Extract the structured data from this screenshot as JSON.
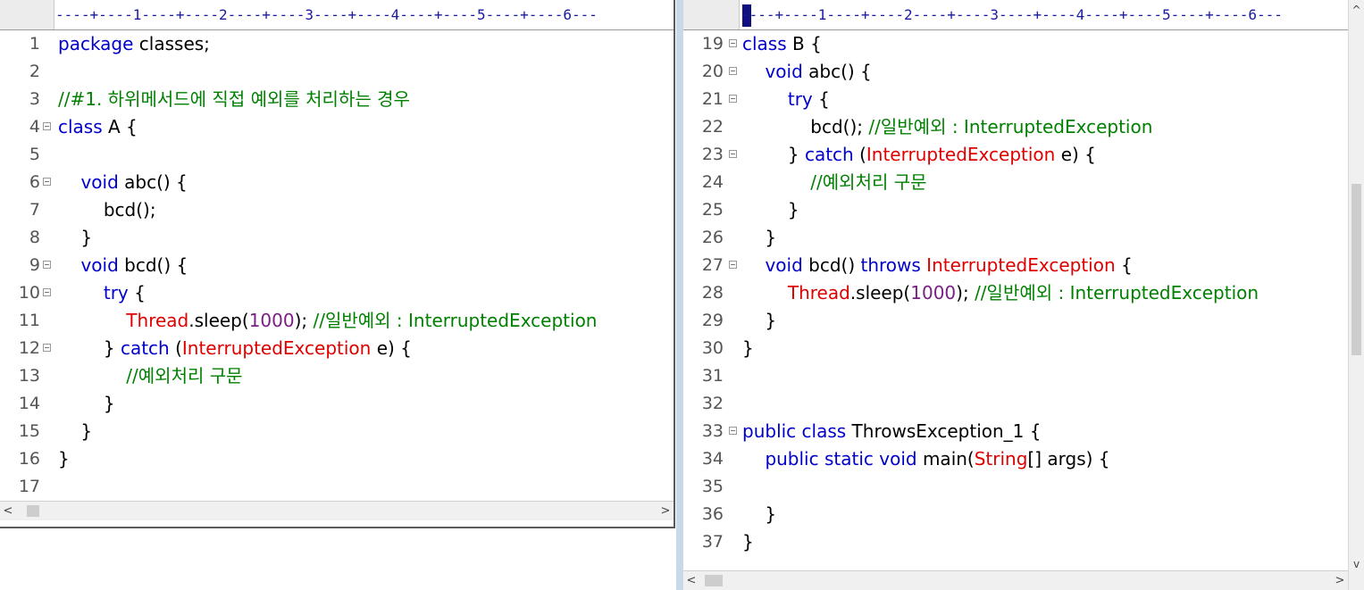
{
  "left_pane": {
    "ruler": "----+----1----+----2----+----3----+----4----+----5----+----6---",
    "lines": [
      {
        "num": "1",
        "fold": false,
        "tokens": [
          {
            "t": "keyword",
            "v": "package"
          },
          {
            "t": "plain",
            "v": " classes;"
          }
        ]
      },
      {
        "num": "2",
        "fold": false,
        "tokens": []
      },
      {
        "num": "3",
        "fold": false,
        "tokens": [
          {
            "t": "comment",
            "v": "//#1. 하위메서드에 직접 예외를 처리하는 경우"
          }
        ]
      },
      {
        "num": "4",
        "fold": true,
        "tokens": [
          {
            "t": "keyword",
            "v": "class"
          },
          {
            "t": "plain",
            "v": " A {"
          }
        ]
      },
      {
        "num": "5",
        "fold": false,
        "tokens": []
      },
      {
        "num": "6",
        "fold": true,
        "tokens": [
          {
            "t": "plain",
            "v": "    "
          },
          {
            "t": "keyword",
            "v": "void"
          },
          {
            "t": "plain",
            "v": " abc() {"
          }
        ]
      },
      {
        "num": "7",
        "fold": false,
        "tokens": [
          {
            "t": "plain",
            "v": "        bcd();"
          }
        ]
      },
      {
        "num": "8",
        "fold": false,
        "tokens": [
          {
            "t": "plain",
            "v": "    }"
          }
        ]
      },
      {
        "num": "9",
        "fold": true,
        "tokens": [
          {
            "t": "plain",
            "v": "    "
          },
          {
            "t": "keyword",
            "v": "void"
          },
          {
            "t": "plain",
            "v": " bcd() {"
          }
        ]
      },
      {
        "num": "10",
        "fold": true,
        "tokens": [
          {
            "t": "plain",
            "v": "        "
          },
          {
            "t": "keyword",
            "v": "try"
          },
          {
            "t": "plain",
            "v": " {"
          }
        ]
      },
      {
        "num": "11",
        "fold": false,
        "tokens": [
          {
            "t": "plain",
            "v": "            "
          },
          {
            "t": "type",
            "v": "Thread"
          },
          {
            "t": "plain",
            "v": ".sleep("
          },
          {
            "t": "number",
            "v": "1000"
          },
          {
            "t": "plain",
            "v": "); "
          },
          {
            "t": "comment",
            "v": "//일반예외 : InterruptedException"
          }
        ]
      },
      {
        "num": "12",
        "fold": true,
        "tokens": [
          {
            "t": "plain",
            "v": "        } "
          },
          {
            "t": "keyword",
            "v": "catch"
          },
          {
            "t": "plain",
            "v": " ("
          },
          {
            "t": "type",
            "v": "InterruptedException"
          },
          {
            "t": "plain",
            "v": " e) {"
          }
        ]
      },
      {
        "num": "13",
        "fold": false,
        "tokens": [
          {
            "t": "plain",
            "v": "            "
          },
          {
            "t": "comment",
            "v": "//예외처리 구문"
          }
        ]
      },
      {
        "num": "14",
        "fold": false,
        "tokens": [
          {
            "t": "plain",
            "v": "        }"
          }
        ]
      },
      {
        "num": "15",
        "fold": false,
        "tokens": [
          {
            "t": "plain",
            "v": "    }"
          }
        ]
      },
      {
        "num": "16",
        "fold": false,
        "tokens": [
          {
            "t": "plain",
            "v": "}"
          }
        ]
      },
      {
        "num": "17",
        "fold": false,
        "tokens": []
      }
    ]
  },
  "right_pane": {
    "ruler": "----+----1----+----2----+----3----+----4----+----5----+----6---",
    "lines": [
      {
        "num": "19",
        "fold": true,
        "tokens": [
          {
            "t": "keyword",
            "v": "class"
          },
          {
            "t": "plain",
            "v": " B {"
          }
        ]
      },
      {
        "num": "20",
        "fold": true,
        "tokens": [
          {
            "t": "plain",
            "v": "    "
          },
          {
            "t": "keyword",
            "v": "void"
          },
          {
            "t": "plain",
            "v": " abc() {"
          }
        ]
      },
      {
        "num": "21",
        "fold": true,
        "tokens": [
          {
            "t": "plain",
            "v": "        "
          },
          {
            "t": "keyword",
            "v": "try"
          },
          {
            "t": "plain",
            "v": " {"
          }
        ]
      },
      {
        "num": "22",
        "fold": false,
        "tokens": [
          {
            "t": "plain",
            "v": "            bcd(); "
          },
          {
            "t": "comment",
            "v": "//일반예외 : InterruptedException"
          }
        ]
      },
      {
        "num": "23",
        "fold": true,
        "tokens": [
          {
            "t": "plain",
            "v": "        } "
          },
          {
            "t": "keyword",
            "v": "catch"
          },
          {
            "t": "plain",
            "v": " ("
          },
          {
            "t": "type",
            "v": "InterruptedException"
          },
          {
            "t": "plain",
            "v": " e) {"
          }
        ]
      },
      {
        "num": "24",
        "fold": false,
        "tokens": [
          {
            "t": "plain",
            "v": "            "
          },
          {
            "t": "comment",
            "v": "//예외처리 구문"
          }
        ]
      },
      {
        "num": "25",
        "fold": false,
        "tokens": [
          {
            "t": "plain",
            "v": "        }"
          }
        ]
      },
      {
        "num": "26",
        "fold": false,
        "tokens": [
          {
            "t": "plain",
            "v": "    }"
          }
        ]
      },
      {
        "num": "27",
        "fold": true,
        "tokens": [
          {
            "t": "plain",
            "v": "    "
          },
          {
            "t": "keyword",
            "v": "void"
          },
          {
            "t": "plain",
            "v": " bcd() "
          },
          {
            "t": "keyword",
            "v": "throws"
          },
          {
            "t": "plain",
            "v": " "
          },
          {
            "t": "type",
            "v": "InterruptedException"
          },
          {
            "t": "plain",
            "v": " {"
          }
        ]
      },
      {
        "num": "28",
        "fold": false,
        "tokens": [
          {
            "t": "plain",
            "v": "        "
          },
          {
            "t": "type",
            "v": "Thread"
          },
          {
            "t": "plain",
            "v": ".sleep("
          },
          {
            "t": "number",
            "v": "1000"
          },
          {
            "t": "plain",
            "v": "); "
          },
          {
            "t": "comment",
            "v": "//일반예외 : InterruptedException"
          }
        ]
      },
      {
        "num": "29",
        "fold": false,
        "tokens": [
          {
            "t": "plain",
            "v": "    }"
          }
        ]
      },
      {
        "num": "30",
        "fold": false,
        "tokens": [
          {
            "t": "plain",
            "v": "}"
          }
        ]
      },
      {
        "num": "31",
        "fold": false,
        "tokens": []
      },
      {
        "num": "32",
        "fold": false,
        "tokens": []
      },
      {
        "num": "33",
        "fold": true,
        "tokens": [
          {
            "t": "keyword",
            "v": "public"
          },
          {
            "t": "plain",
            "v": " "
          },
          {
            "t": "keyword",
            "v": "class"
          },
          {
            "t": "plain",
            "v": " ThrowsException_1 {"
          }
        ]
      },
      {
        "num": "34",
        "fold": false,
        "tokens": [
          {
            "t": "plain",
            "v": "    "
          },
          {
            "t": "keyword",
            "v": "public"
          },
          {
            "t": "plain",
            "v": " "
          },
          {
            "t": "keyword",
            "v": "static"
          },
          {
            "t": "plain",
            "v": " "
          },
          {
            "t": "keyword",
            "v": "void"
          },
          {
            "t": "plain",
            "v": " main("
          },
          {
            "t": "type",
            "v": "String"
          },
          {
            "t": "plain",
            "v": "[] args) {"
          }
        ]
      },
      {
        "num": "35",
        "fold": false,
        "tokens": []
      },
      {
        "num": "36",
        "fold": false,
        "tokens": [
          {
            "t": "plain",
            "v": "    }"
          }
        ]
      },
      {
        "num": "37",
        "fold": false,
        "tokens": [
          {
            "t": "plain",
            "v": "}"
          }
        ]
      }
    ]
  },
  "scrollbar": {
    "left_arrow": "<",
    "right_arrow": ">",
    "up_arrow": "^",
    "down_arrow": "v"
  },
  "colors": {
    "keyword": "#0000cc",
    "type": "#e00000",
    "comment": "#008000",
    "number": "#7a1f86",
    "plain": "#000000"
  }
}
